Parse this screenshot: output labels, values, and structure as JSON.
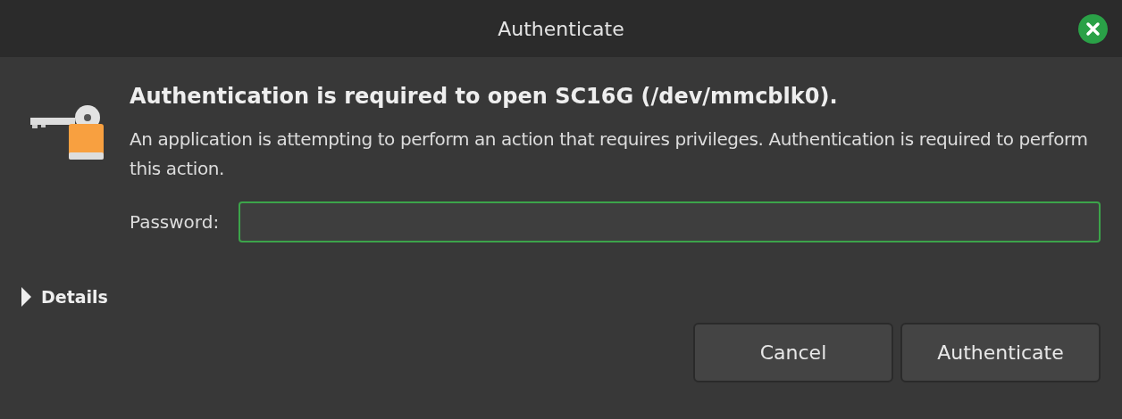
{
  "window": {
    "title": "Authenticate"
  },
  "heading": "Authentication is required to open SC16G (/dev/mmcblk0).",
  "message": "An application is attempting to perform an action that requires privileges. Authentication is required to perform this action.",
  "password": {
    "label": "Password:",
    "focused": true
  },
  "details": {
    "label": "Details",
    "expanded": false
  },
  "buttons": [
    {
      "label": "Cancel"
    },
    {
      "label": "Authenticate"
    }
  ]
}
